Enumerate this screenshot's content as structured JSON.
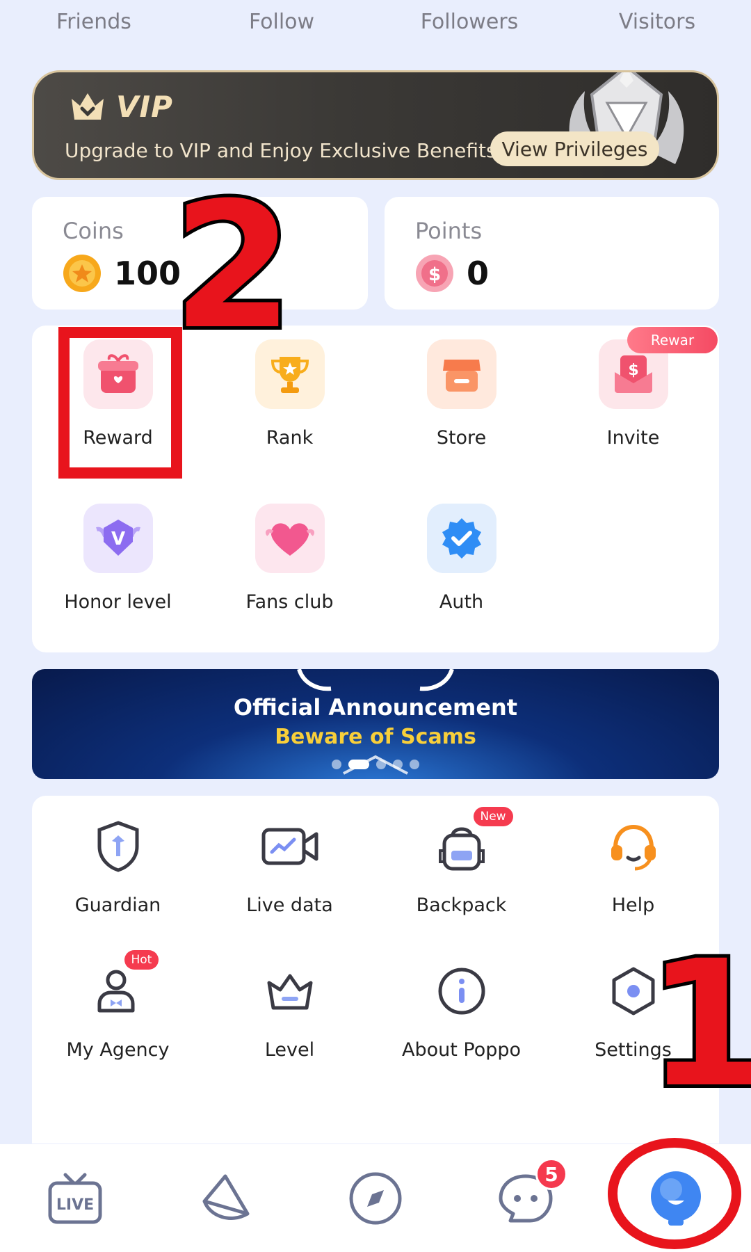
{
  "top_tabs": [
    "Friends",
    "Follow",
    "Followers",
    "Visitors"
  ],
  "vip": {
    "title": "VIP",
    "subtitle": "Upgrade to VIP and Enjoy Exclusive Benefits",
    "button": "View Privileges"
  },
  "stats": {
    "coins_label": "Coins",
    "coins_value": "100",
    "points_label": "Points",
    "points_value": "0"
  },
  "features": {
    "items": [
      {
        "label": "Reward",
        "icon": "gift-icon"
      },
      {
        "label": "Rank",
        "icon": "trophy-icon"
      },
      {
        "label": "Store",
        "icon": "store-icon"
      },
      {
        "label": "Invite",
        "icon": "invite-envelope-icon"
      },
      {
        "label": "Honor level",
        "icon": "honor-shield-icon"
      },
      {
        "label": "Fans club",
        "icon": "heart-icon"
      },
      {
        "label": "Auth",
        "icon": "verified-badge-icon"
      }
    ],
    "invite_badge": "Rewar"
  },
  "banner": {
    "title": "Official Announcement",
    "subtitle": "Beware of Scams"
  },
  "tools": {
    "items": [
      {
        "label": "Guardian",
        "icon": "guardian-shield-icon"
      },
      {
        "label": "Live data",
        "icon": "live-data-camera-icon"
      },
      {
        "label": "Backpack",
        "icon": "backpack-icon",
        "badge": "New"
      },
      {
        "label": "Help",
        "icon": "headset-icon"
      },
      {
        "label": "My Agency",
        "icon": "agency-person-icon",
        "badge": "Hot"
      },
      {
        "label": "Level",
        "icon": "crown-icon"
      },
      {
        "label": "About Poppo",
        "icon": "info-icon"
      },
      {
        "label": "Settings",
        "icon": "settings-hexagon-icon"
      }
    ]
  },
  "bottom_nav": {
    "live_label": "LIVE",
    "message_count": "5"
  },
  "annotations": {
    "step1": "1",
    "step2": "2"
  },
  "colors": {
    "background": "#e9eefd",
    "annotation_red": "#e8141c",
    "vip_gold": "#f3dfb6",
    "badge_red": "#f53b4f"
  }
}
